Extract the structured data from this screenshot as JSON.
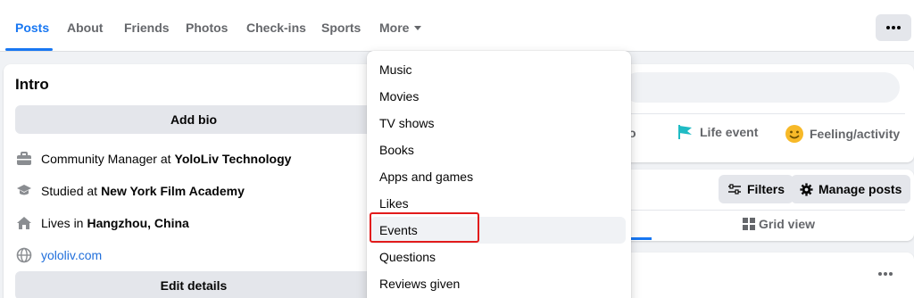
{
  "tabs": [
    {
      "label": "Posts",
      "active": true
    },
    {
      "label": "About"
    },
    {
      "label": "Friends"
    },
    {
      "label": "Photos"
    },
    {
      "label": "Check-ins"
    },
    {
      "label": "Sports"
    },
    {
      "label": "More"
    }
  ],
  "intro": {
    "title": "Intro",
    "add_bio_label": "Add bio",
    "work_prefix": "Community Manager at",
    "work_place": "YoloLiv Technology",
    "study_prefix": "Studied at",
    "study_place": "New York Film Academy",
    "lives_prefix": "Lives in",
    "lives_place": "Hangzhou, China",
    "website": "yololiv.com",
    "edit_details_label": "Edit details"
  },
  "composer": {
    "partial_label": "o",
    "life_event_label": "Life event",
    "feeling_label": "Feeling/activity"
  },
  "posts_toolbar": {
    "filters_label": "Filters",
    "manage_posts_label": "Manage posts",
    "grid_view_label": "Grid view"
  },
  "dropdown": {
    "items": [
      {
        "label": "Music"
      },
      {
        "label": "Movies"
      },
      {
        "label": "TV shows"
      },
      {
        "label": "Books"
      },
      {
        "label": "Apps and games"
      },
      {
        "label": "Likes"
      },
      {
        "label": "Events",
        "hovered": true
      },
      {
        "label": "Questions"
      },
      {
        "label": "Reviews given"
      }
    ]
  },
  "colors": {
    "accent": "#1877f2",
    "highlight": "#e21b1b",
    "feeling_icon": "#f7b928",
    "life_event_icon": "#1fbbc4"
  },
  "icons": {
    "work": "briefcase-icon",
    "study": "graduation-cap-icon",
    "home": "home-icon",
    "website": "globe-icon",
    "life_event": "flag-icon",
    "feeling": "smiley-icon",
    "filters": "sliders-icon",
    "manage": "gear-icon",
    "grid": "grid-icon"
  }
}
